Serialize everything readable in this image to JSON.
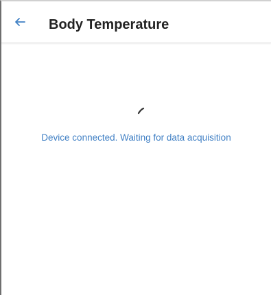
{
  "app_bar": {
    "title": "Body Temperature",
    "back_icon": "arrow-left-icon"
  },
  "main": {
    "spinner_icon": "loading-spinner-icon",
    "status_text": "Device connected. Waiting for data acquisition"
  },
  "colors": {
    "accent": "#3f7fc4",
    "title": "#222222",
    "spinner": "#333333"
  }
}
